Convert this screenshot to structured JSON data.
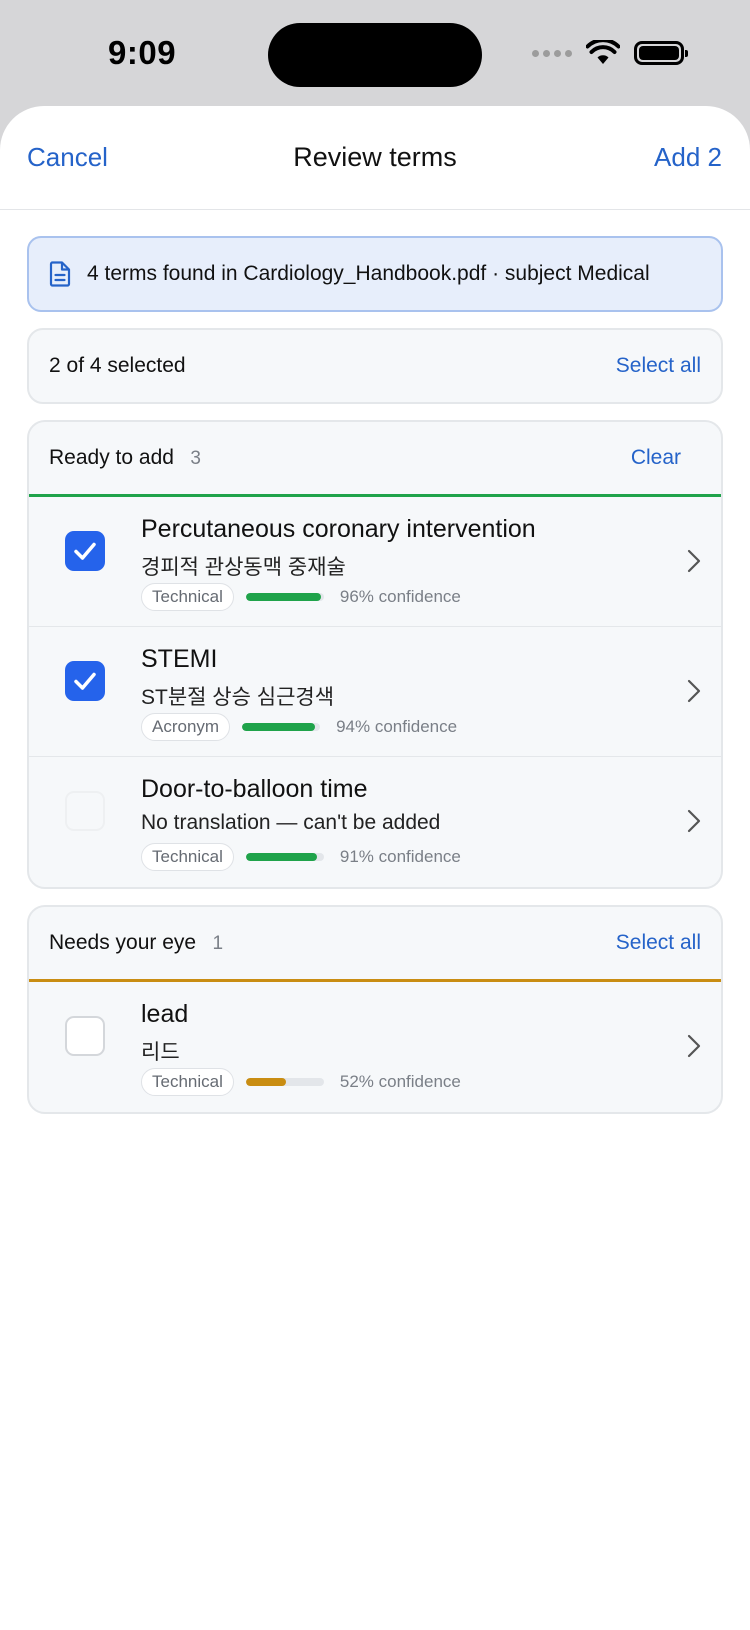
{
  "status_bar": {
    "time": "9:09"
  },
  "nav": {
    "cancel_label": "Cancel",
    "title": "Review terms",
    "add_label": "Add 2"
  },
  "banner": {
    "text": "4 terms found in Cardiology_Handbook.pdf · subject Medical"
  },
  "selection": {
    "text": "2 of 4 selected",
    "select_all_label": "Select all"
  },
  "groups": [
    {
      "title": "Ready to add",
      "count": "3",
      "action_label": "Clear",
      "accent": "#1fa34a",
      "items": [
        {
          "term": "Percutaneous coronary intervention",
          "translation": "경피적 관상동맥 중재술",
          "tag": "Technical",
          "confidence": 0.96,
          "confidence_label": "96% confidence",
          "state": "checked"
        },
        {
          "term": "STEMI",
          "translation": "ST분절 상승 심근경색",
          "tag": "Acronym",
          "confidence": 0.94,
          "confidence_label": "94% confidence",
          "state": "checked"
        },
        {
          "term": "Door-to-balloon time",
          "translation": "No translation — can't be added",
          "tag": "Technical",
          "confidence": 0.91,
          "confidence_label": "91% confidence",
          "state": "disabled"
        }
      ]
    },
    {
      "title": "Needs your eye",
      "count": "1",
      "action_label": "Select all",
      "accent": "#c98d12",
      "items": [
        {
          "term": "lead",
          "translation": "리드",
          "tag": "Technical",
          "confidence": 0.52,
          "confidence_label": "52% confidence",
          "state": "unchecked"
        }
      ]
    }
  ],
  "colors": {
    "link": "#2563c9",
    "checkbox": "#2563eb",
    "high_confidence": "#1fa34a",
    "low_confidence": "#c98d12"
  },
  "icons": {
    "banner": "document-icon",
    "row": "chevron-right-icon",
    "check": "checkmark-icon"
  }
}
